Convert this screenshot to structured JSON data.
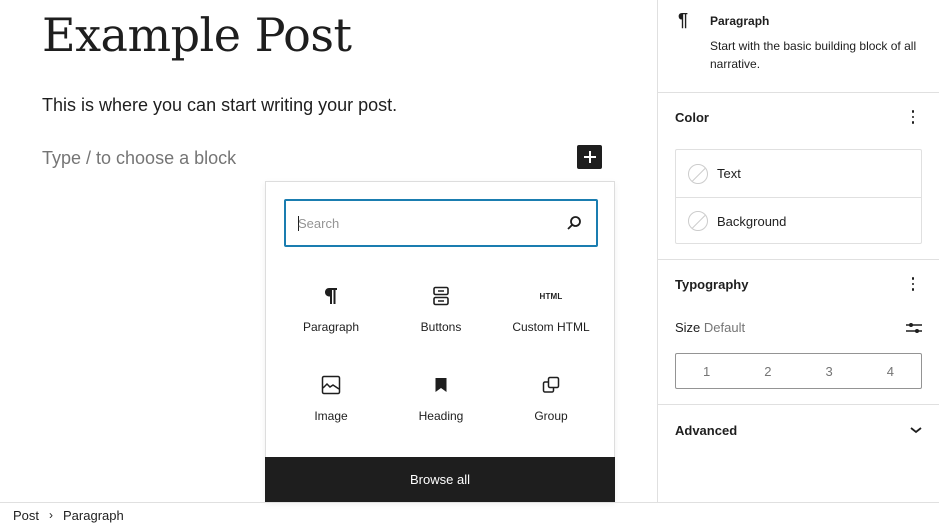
{
  "editor": {
    "title": "Example Post",
    "paragraph": "This is where you can start writing your post.",
    "placeholder": "Type / to choose a block",
    "inserter_toggle_icon": "plus-icon"
  },
  "inserter": {
    "search": {
      "value": "",
      "placeholder": "Search",
      "icon": "search-icon"
    },
    "blocks": [
      {
        "label": "Paragraph",
        "icon": "paragraph-icon"
      },
      {
        "label": "Buttons",
        "icon": "buttons-icon"
      },
      {
        "label": "Custom HTML",
        "icon": "html-icon",
        "icon_text": "HTML"
      },
      {
        "label": "Image",
        "icon": "image-icon"
      },
      {
        "label": "Heading",
        "icon": "bookmark-icon"
      },
      {
        "label": "Group",
        "icon": "group-icon"
      }
    ],
    "browse_all": "Browse all"
  },
  "sidebar": {
    "block_card": {
      "icon": "¶",
      "title": "Paragraph",
      "description": "Start with the basic building block of all narrative."
    },
    "color": {
      "title": "Color",
      "items": [
        {
          "label": "Text"
        },
        {
          "label": "Background"
        }
      ]
    },
    "typography": {
      "title": "Typography",
      "size_label": "Size",
      "size_value": "Default",
      "size_options": [
        "1",
        "2",
        "3",
        "4"
      ]
    },
    "advanced": {
      "title": "Advanced"
    }
  },
  "breadcrumb": {
    "items": [
      "Post",
      "Paragraph"
    ],
    "separator": "›"
  },
  "colors": {
    "accent": "#1a7db0",
    "dark": "#1e1e1e",
    "muted": "#757575",
    "border": "#e0e0e0"
  }
}
